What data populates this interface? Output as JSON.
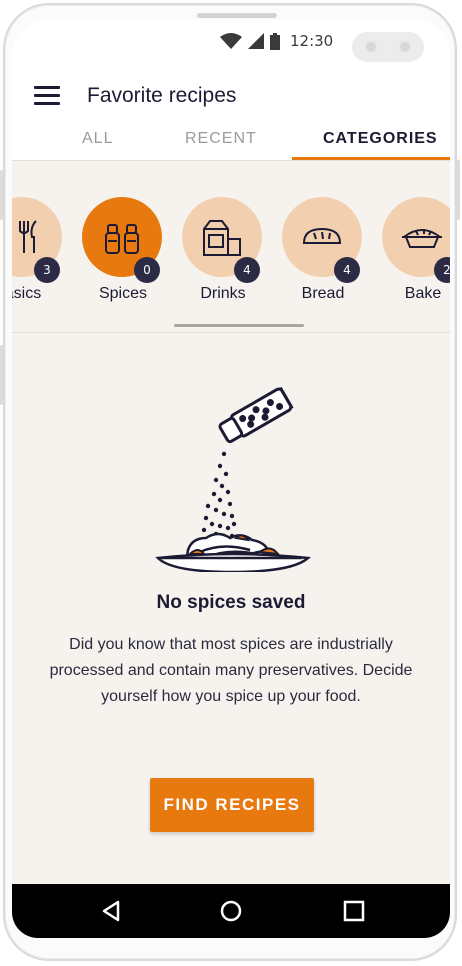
{
  "status_bar": {
    "time": "12:30",
    "icons": [
      "wifi-icon",
      "signal-icon",
      "battery-icon"
    ]
  },
  "app_bar": {
    "title": "Favorite recipes",
    "menu_icon": "hamburger-menu-icon"
  },
  "tabs": [
    {
      "label": "ALL",
      "active": false
    },
    {
      "label": "RECENT",
      "active": false
    },
    {
      "label": "CATEGORIES",
      "active": true
    }
  ],
  "categories": [
    {
      "label": "asics",
      "count": "3",
      "icon": "cutlery-icon",
      "selected": false
    },
    {
      "label": "Spices",
      "count": "0",
      "icon": "spice-shakers-icon",
      "selected": true
    },
    {
      "label": "Drinks",
      "count": "4",
      "icon": "drinks-icon",
      "selected": false
    },
    {
      "label": "Bread",
      "count": "4",
      "icon": "bread-icon",
      "selected": false
    },
    {
      "label": "Bake",
      "count": "2",
      "icon": "pie-icon",
      "selected": false
    }
  ],
  "empty_state": {
    "illustration": "spice-shaker-over-pasta-illustration",
    "title": "No spices saved",
    "body": "Did you know that most spices are industrially processed and contain many preservatives. Decide yourself how you spice up your food."
  },
  "cta": {
    "label": "FIND RECIPES"
  },
  "nav_bar": {
    "icons": [
      "back-icon",
      "home-icon",
      "recents-icon"
    ]
  },
  "colors": {
    "accent": "#e7790f",
    "category_circle": "#f2cfae",
    "badge": "#2c2b46",
    "text_primary": "#1c1b33",
    "background": "#f6f3ef"
  }
}
